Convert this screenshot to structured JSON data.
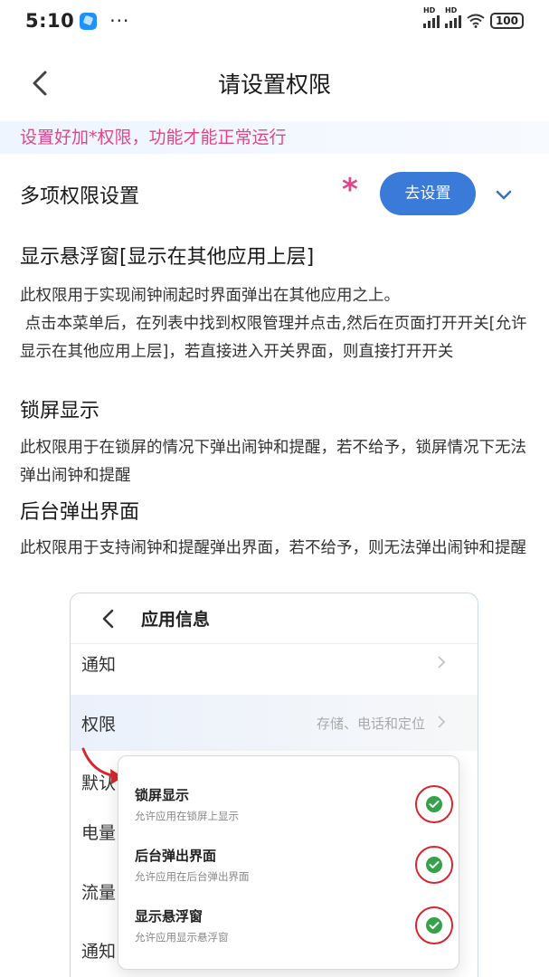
{
  "status_bar": {
    "time": "5:10",
    "dots": "···",
    "battery": "100",
    "signal_label": "HD"
  },
  "header": {
    "title": "请设置权限",
    "back_icon": "chevron-left-icon"
  },
  "notice": "设置好加*权限，功能才能正常运行",
  "multi": {
    "label": "多项权限设置",
    "asterisk": "*",
    "button_label": "去设置",
    "expand_icon": "chevron-down-icon"
  },
  "sections": [
    {
      "title": "显示悬浮窗[显示在其他应用上层]",
      "desc": "此权限用于实现闹钟闹起时界面弹出在其他应用之上。\n 点击本菜单后，在列表中找到权限管理并点击,然后在页面打开开关[允许显示在其他应用上层]，若直接进入开关界面，则直接打开开关"
    },
    {
      "title": "锁屏显示",
      "desc": "此权限用于在锁屏的情况下弹出闹钟和提醒，若不给予，锁屏情况下无法弹出闹钟和提醒"
    },
    {
      "title": "后台弹出界面",
      "desc": "此权限用于支持闹钟和提醒弹出界面，若不给予，则无法弹出闹钟和提醒"
    }
  ],
  "illustration": {
    "title": "应用信息",
    "rows": [
      {
        "label": "通知",
        "value": ""
      },
      {
        "label": "权限",
        "value": "存储、电话和定位"
      },
      {
        "label": "默认",
        "value": ""
      },
      {
        "label": "电量",
        "value": ""
      },
      {
        "label": "流量",
        "value": ""
      },
      {
        "label": "通知",
        "value": ""
      }
    ],
    "popup_items": [
      {
        "title": "锁屏显示",
        "subtitle": "允许应用在锁屏上显示"
      },
      {
        "title": "后台弹出界面",
        "subtitle": "允许应用在后台弹出界面"
      },
      {
        "title": "显示悬浮窗",
        "subtitle": "允许应用显示悬浮窗"
      }
    ],
    "accent_colors": {
      "check": "#34a24a",
      "ring": "#d8262f",
      "arrow": "#d8262f"
    }
  },
  "colors": {
    "accent_pink": "#e0468a",
    "button_blue": "#3a7ad9"
  }
}
